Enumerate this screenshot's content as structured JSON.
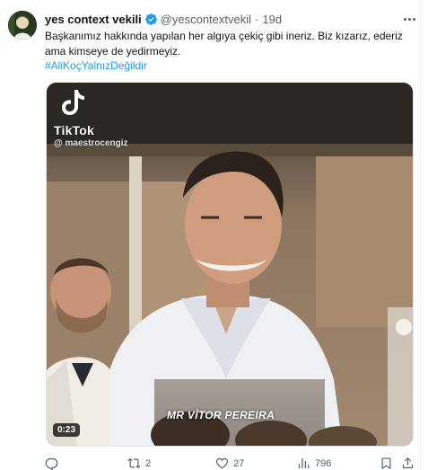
{
  "tweet": {
    "author": {
      "display_name": "yes context vekili",
      "handle": "@yescontextvekil",
      "verified_icon": "verified-badge-icon",
      "avatar": "avatar"
    },
    "separator": "·",
    "time": "19d",
    "more_icon": "more-dots-icon",
    "text_line_1": "Başkanımız hakkında yapılan her algıya çekiç gibi ineriz. Biz kızarız, ederiz",
    "text_line_2": "ama kimseye de yedirmeyiz.",
    "hashtag": "#AliKoçYalnızDeğildir"
  },
  "media": {
    "watermark_brand": "TikTok",
    "watermark_user": "@ maestrocengiz",
    "caption_overlay": "MR VİTOR PEREIRA",
    "duration": "0:23"
  },
  "actions": {
    "reply": {
      "icon": "reply-icon",
      "count": ""
    },
    "retweet": {
      "icon": "retweet-icon",
      "count": "2"
    },
    "like": {
      "icon": "heart-icon",
      "count": "27"
    },
    "views": {
      "icon": "views-icon",
      "count": "796"
    },
    "bookmark": {
      "icon": "bookmark-icon"
    },
    "share": {
      "icon": "share-icon"
    }
  },
  "colors": {
    "accent": "#1d9bf0",
    "text": "#0f1419",
    "muted": "#536471"
  }
}
